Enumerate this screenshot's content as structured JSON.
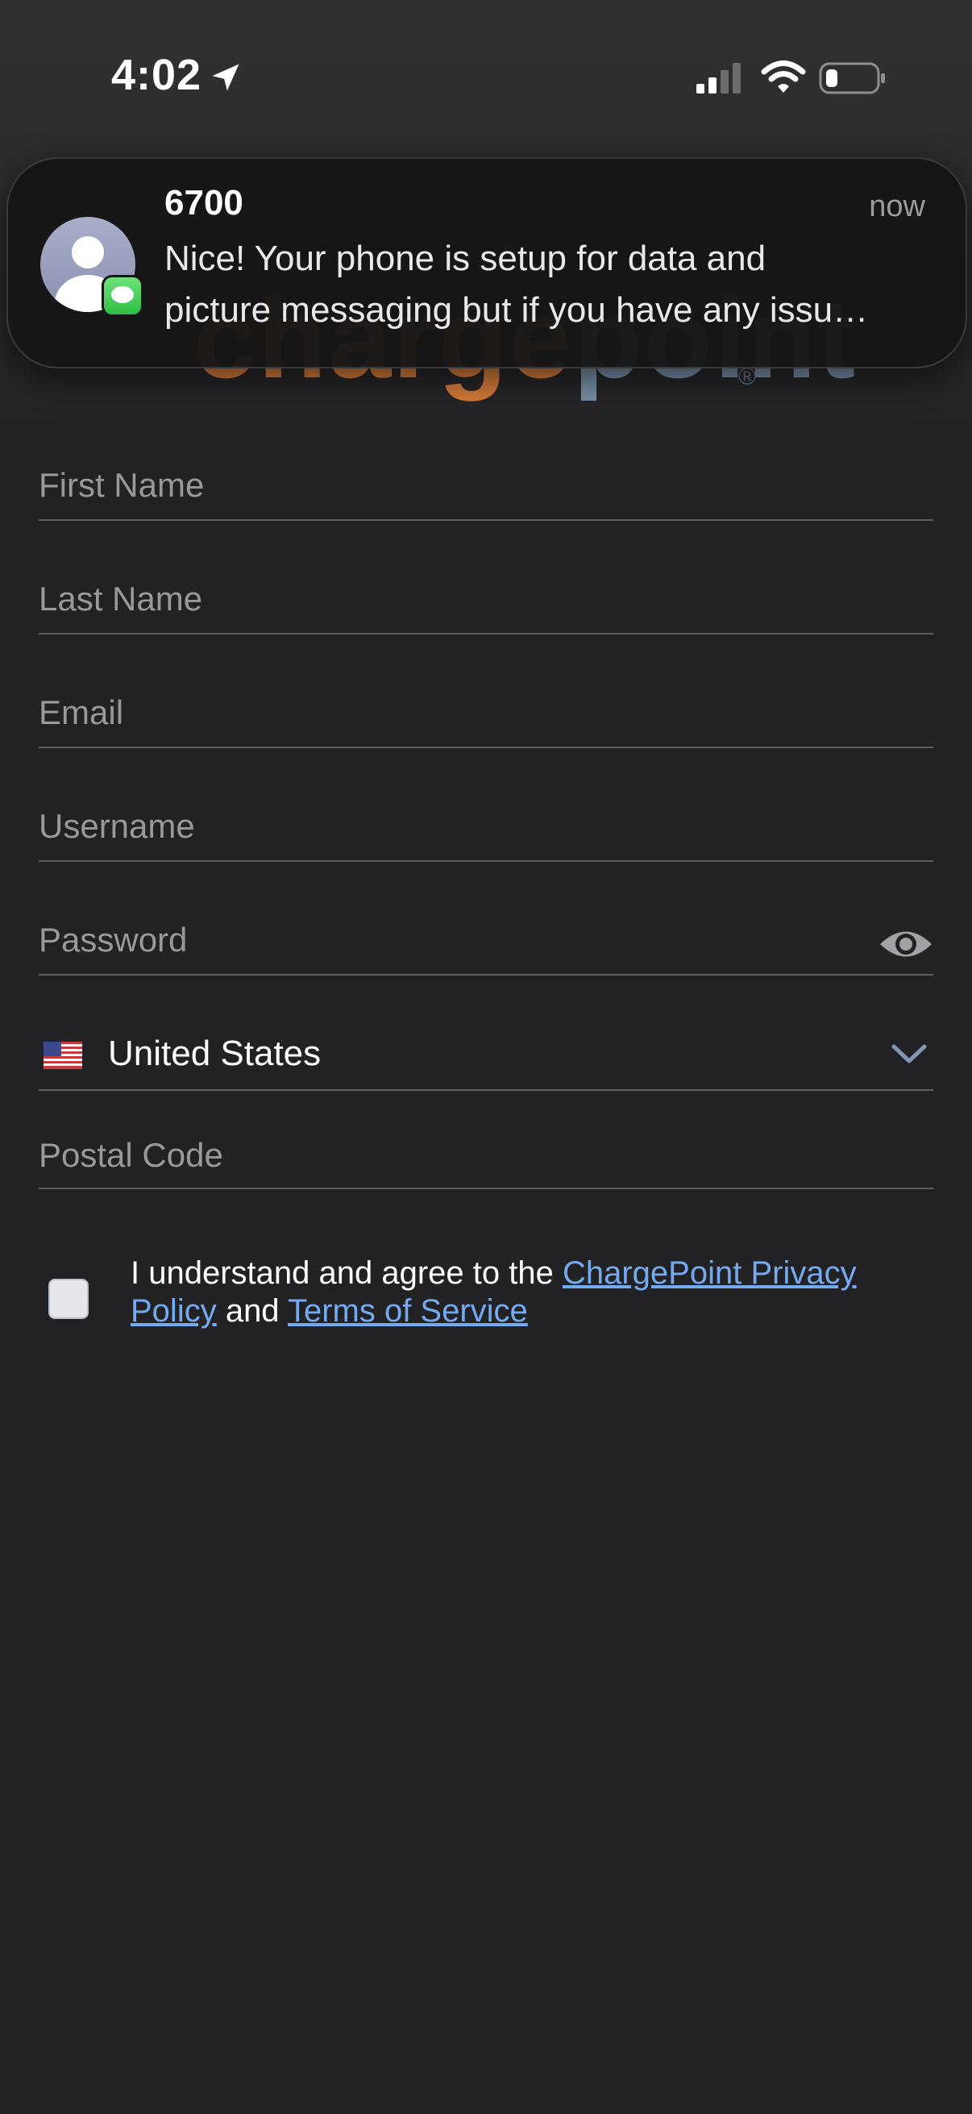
{
  "status_bar": {
    "time": "4:02"
  },
  "logo": {
    "text_part1": "charge",
    "text_part2": "point",
    "registered_mark": "®"
  },
  "notification": {
    "sender": "6700",
    "time": "now",
    "body_line1": "Nice! Your phone is setup for data and",
    "body_line2": "picture messaging but if you have any issu…"
  },
  "form": {
    "first_name_placeholder": "First Name",
    "last_name_placeholder": "Last Name",
    "email_placeholder": "Email",
    "username_placeholder": "Username",
    "password_placeholder": "Password",
    "country": "United States",
    "postal_code_placeholder": "Postal Code"
  },
  "agreement": {
    "text_prefix": "I understand and agree to the ",
    "privacy_link": "ChargePoint Privacy Policy",
    "conjunction": " and ",
    "terms_link": "Terms of Service",
    "checked": false
  },
  "colors": {
    "background": "#222224",
    "link": "#74aaf0",
    "logo_orange": "#e2813a",
    "logo_blue": "#7f98b3"
  }
}
